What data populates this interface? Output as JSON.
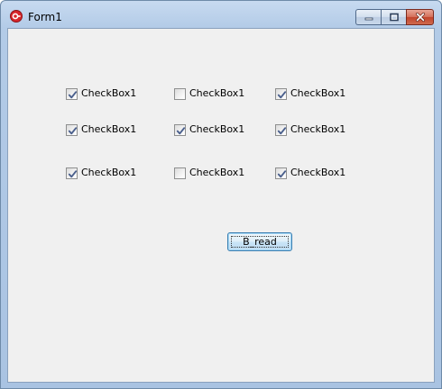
{
  "window": {
    "title": "Form1"
  },
  "colors": {
    "titlebar": "#b3cbe7",
    "client_bg": "#f0f0f0",
    "close_button": "#c1432a",
    "check_mark": "#4a5f8c"
  },
  "checkboxes": [
    {
      "label": "CheckBox1",
      "checked": true
    },
    {
      "label": "CheckBox1",
      "checked": false
    },
    {
      "label": "CheckBox1",
      "checked": true
    },
    {
      "label": "CheckBox1",
      "checked": true
    },
    {
      "label": "CheckBox1",
      "checked": true
    },
    {
      "label": "CheckBox1",
      "checked": true
    },
    {
      "label": "CheckBox1",
      "checked": true
    },
    {
      "label": "CheckBox1",
      "checked": false
    },
    {
      "label": "CheckBox1",
      "checked": true
    }
  ],
  "button": {
    "label": "B_read"
  }
}
